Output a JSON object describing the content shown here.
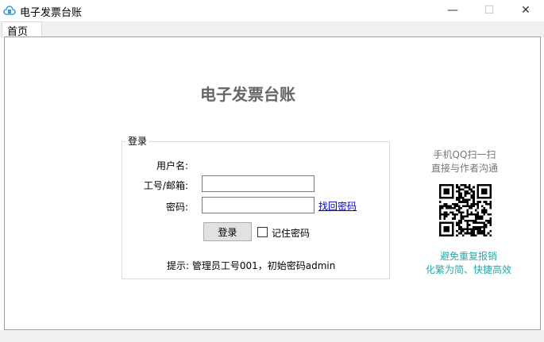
{
  "window": {
    "title": "电子发票台账",
    "minimize": "—",
    "maximize": "☐",
    "close": "✕"
  },
  "tabs": [
    {
      "label": "首页"
    }
  ],
  "main": {
    "heading": "电子发票台账",
    "login": {
      "legend": "登录",
      "username_label": "用户名:",
      "account_label": "工号/邮箱:",
      "account_value": "",
      "password_label": "密码:",
      "password_value": "",
      "forgot_link": "找回密码",
      "login_button": "登录",
      "remember_label": "记住密码",
      "remember_checked": false,
      "hint": "提示: 管理员工号001，初始密码admin"
    },
    "side": {
      "line1": "手机QQ扫一扫",
      "line2": "直接与作者沟通",
      "line3": "避免重复报销",
      "line4": "化繁为简、快捷高效"
    }
  },
  "colors": {
    "accent": "#2aa8a8",
    "link": "#0000cc",
    "heading": "#666666"
  }
}
